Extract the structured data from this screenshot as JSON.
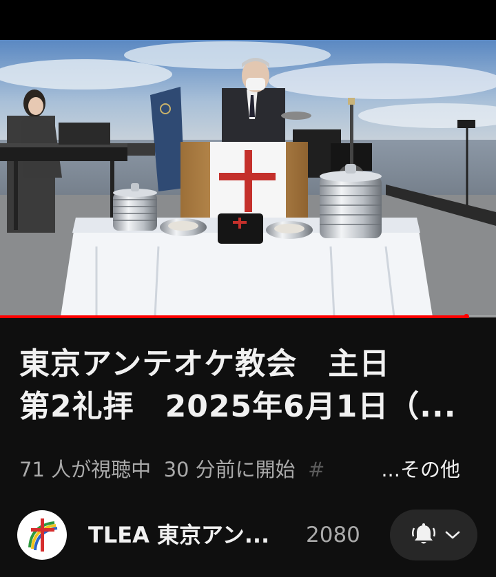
{
  "video": {
    "progress_fraction": 0.94
  },
  "title": {
    "line1": "東京アンテオケ教会　主日",
    "line2": "第2礼拝　2025年6月1日（..."
  },
  "meta": {
    "viewers": "71 人が視聴中",
    "started": "30 分前に開始",
    "hashtag": "#",
    "more": "...その他"
  },
  "channel": {
    "name": "TLEA 東京アン...",
    "subscribers": "2080"
  },
  "icons": {
    "bell": "bell-ring-icon",
    "chevron": "chevron-down-icon"
  }
}
